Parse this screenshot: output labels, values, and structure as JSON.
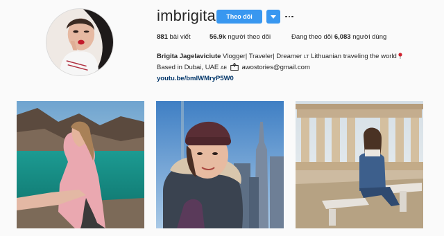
{
  "profile": {
    "username": "imbrigita",
    "follow_label": "Theo dõi",
    "stats": {
      "posts_count": "881",
      "posts_label": "bài viết",
      "followers_count": "56.9k",
      "followers_label": "người theo dõi",
      "following_prefix": "Đang theo dõi",
      "following_count": "6,083",
      "following_label": "người dùng"
    },
    "bio": {
      "full_name": "Brigita Jagelaviciute",
      "line1_text": "Vlogger| Traveler| Dreamer",
      "flag_lt": "LT",
      "line1_text_b": "Lithuanian traveling the world",
      "line2_text": "Based in Dubai, UAE",
      "flag_ae": "AE",
      "email": "awostories@gmail.com",
      "link": "youtu.be/bmIWMryP5W0"
    }
  },
  "colors": {
    "accent": "#3897f0",
    "link": "#003569",
    "background": "#fafafa"
  },
  "icons": [
    "chevron-down-icon",
    "more-options-icon",
    "pin-icon",
    "email-box-icon"
  ]
}
